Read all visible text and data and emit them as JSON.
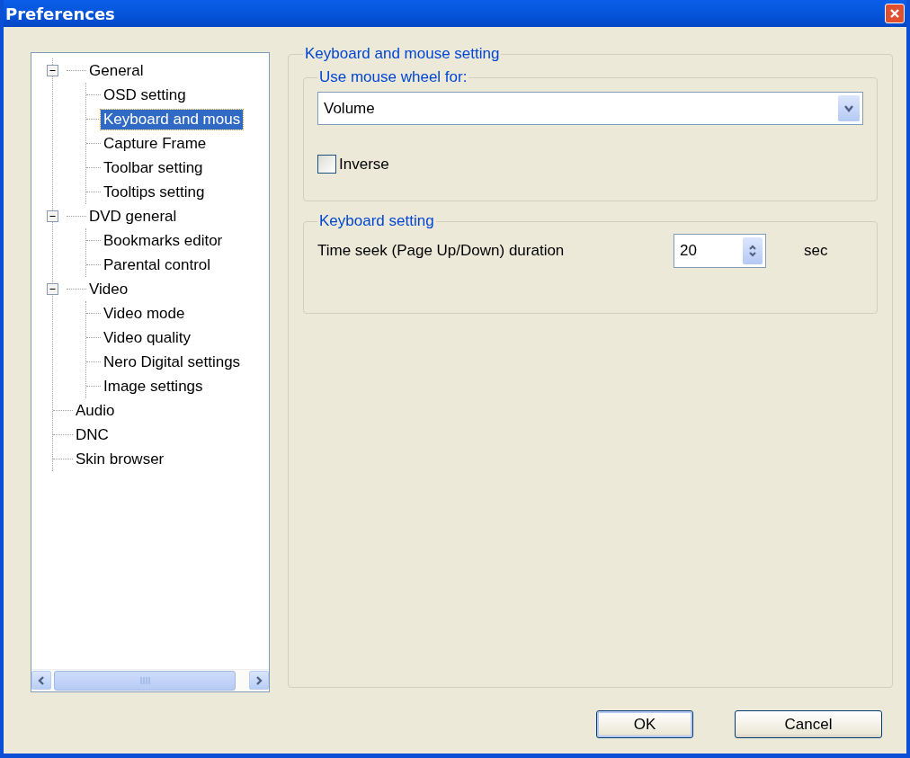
{
  "window": {
    "title": "Preferences"
  },
  "tree": [
    {
      "label": "General",
      "selected": false,
      "expanded": true,
      "children": [
        {
          "label": "OSD setting",
          "selected": false
        },
        {
          "label": "Keyboard and mous",
          "selected": true
        },
        {
          "label": "Capture Frame",
          "selected": false
        },
        {
          "label": "Toolbar setting",
          "selected": false
        },
        {
          "label": "Tooltips setting",
          "selected": false
        }
      ]
    },
    {
      "label": "DVD general",
      "selected": false,
      "expanded": true,
      "children": [
        {
          "label": "Bookmarks editor",
          "selected": false
        },
        {
          "label": "Parental control",
          "selected": false
        }
      ]
    },
    {
      "label": "Video",
      "selected": false,
      "expanded": true,
      "children": [
        {
          "label": "Video mode",
          "selected": false
        },
        {
          "label": "Video quality",
          "selected": false
        },
        {
          "label": "Nero Digital settings",
          "selected": false
        },
        {
          "label": "Image settings",
          "selected": false
        }
      ]
    },
    {
      "label": "Audio",
      "selected": false
    },
    {
      "label": "DNC",
      "selected": false
    },
    {
      "label": "Skin browser",
      "selected": false
    }
  ],
  "settings": {
    "title": "Keyboard and mouse setting",
    "mouse_group": {
      "title": "Use mouse wheel for:",
      "dropdown": {
        "value": "Volume"
      },
      "inverse": {
        "label": "Inverse",
        "checked": false
      }
    },
    "keyboard_group": {
      "title": "Keyboard setting",
      "time_seek": {
        "label": "Time seek (Page Up/Down) duration",
        "value": "20",
        "unit": "sec"
      }
    }
  },
  "buttons": [
    "OK",
    "Cancel"
  ]
}
